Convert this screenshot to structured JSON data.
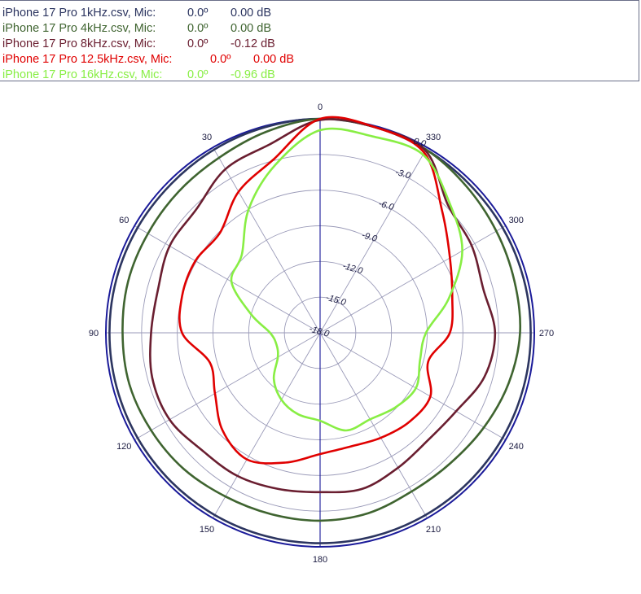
{
  "legend": [
    {
      "name": "iPhone 17 Pro 1kHz.csv, Mic:",
      "angle": "0.0º",
      "level": "0.00 dB",
      "color": "#2c3560"
    },
    {
      "name": "iPhone 17 Pro 4kHz.csv, Mic:",
      "angle": "0.0º",
      "level": "0.00 dB",
      "color": "#3f6430"
    },
    {
      "name": "iPhone 17 Pro 8kHz.csv, Mic:",
      "angle": "0.0º",
      "level": "-0.12 dB",
      "color": "#6a1e30"
    },
    {
      "name": "iPhone 17 Pro 12.5kHz.csv, Mic:",
      "angle": "0.0º",
      "level": "0.00 dB",
      "color": "#e00000"
    },
    {
      "name": "iPhone 17 Pro 16kHz.csv, Mic:",
      "angle": "0.0º",
      "level": "-0.96 dB",
      "color": "#88ee44"
    }
  ],
  "chart_data": {
    "type": "polar",
    "angle_labels": [
      "0",
      "30",
      "60",
      "90",
      "120",
      "150",
      "180",
      "210",
      "240",
      "270",
      "300",
      "330"
    ],
    "radial_labels": [
      "0.0",
      "-3.0",
      "-6.0",
      "-9.0",
      "-12.0",
      "-15.0",
      "-18.0"
    ],
    "rlim": [
      -18,
      0
    ],
    "outer_circle_color": "#1a1a99",
    "spoke_color": "#9a9ab8",
    "zero_spoke_color": "#1a1a99",
    "series": [
      {
        "name": "iPhone 17 Pro 1kHz.csv, Mic:",
        "color": "#2c3560",
        "angles": [
          0,
          15,
          30,
          45,
          60,
          75,
          90,
          105,
          120,
          135,
          150,
          165,
          180,
          195,
          210,
          225,
          240,
          255,
          270,
          285,
          300,
          315,
          330,
          345
        ],
        "values": [
          0,
          -0.1,
          -0.2,
          -0.3,
          -0.3,
          -0.3,
          -0.3,
          -0.3,
          -0.3,
          -0.3,
          -0.3,
          -0.3,
          -0.3,
          -0.3,
          -0.3,
          -0.3,
          -0.3,
          -0.3,
          -0.3,
          -0.3,
          -0.3,
          -0.3,
          -0.2,
          -0.1
        ]
      },
      {
        "name": "iPhone 17 Pro 4kHz.csv, Mic:",
        "color": "#3f6430",
        "angles": [
          0,
          15,
          30,
          45,
          60,
          75,
          90,
          105,
          120,
          135,
          150,
          165,
          180,
          195,
          210,
          225,
          240,
          255,
          270,
          285,
          300,
          315,
          330,
          345
        ],
        "values": [
          0,
          -0.5,
          -1.0,
          -1.2,
          -1.3,
          -1.3,
          -1.4,
          -1.4,
          -1.6,
          -1.8,
          -2.1,
          -2.2,
          -2.2,
          -2.3,
          -2.6,
          -2.5,
          -2.1,
          -1.6,
          -1.2,
          -1.1,
          -0.9,
          -0.6,
          -0.2,
          -0.1
        ]
      },
      {
        "name": "iPhone 17 Pro 8kHz.csv, Mic:",
        "color": "#6a1e30",
        "angles": [
          0,
          15,
          30,
          45,
          60,
          75,
          90,
          105,
          120,
          135,
          150,
          165,
          180,
          195,
          210,
          225,
          240,
          255,
          270,
          285,
          300,
          315,
          330,
          345
        ],
        "values": [
          -0.1,
          -1.6,
          -2.1,
          -3.3,
          -3.4,
          -3.9,
          -3.8,
          -3.4,
          -3.4,
          -4.0,
          -4.1,
          -4.4,
          -4.6,
          -4.4,
          -4.9,
          -5.2,
          -4.8,
          -3.7,
          -3.3,
          -3.8,
          -3.3,
          -2.8,
          -0.3,
          -0.1
        ]
      },
      {
        "name": "iPhone 17 Pro 12.5kHz.csv, Mic:",
        "color": "#e00000",
        "angles": [
          0,
          15,
          30,
          45,
          60,
          75,
          90,
          105,
          120,
          135,
          150,
          165,
          180,
          195,
          210,
          225,
          240,
          255,
          270,
          285,
          300,
          315,
          330,
          345
        ],
        "values": [
          0,
          -2.9,
          -4.3,
          -6.1,
          -5.9,
          -6.0,
          -6.4,
          -8.4,
          -7.8,
          -6.4,
          -5.7,
          -6.7,
          -7.8,
          -8.1,
          -7.8,
          -7.4,
          -7.3,
          -8.6,
          -7.1,
          -6.5,
          -5.4,
          -3.5,
          -0.5,
          -0.1
        ]
      },
      {
        "name": "iPhone 17 Pro 16kHz.csv, Mic:",
        "color": "#88ee44",
        "angles": [
          0,
          15,
          30,
          45,
          60,
          75,
          90,
          105,
          120,
          135,
          150,
          165,
          180,
          195,
          210,
          225,
          240,
          255,
          270,
          285,
          300,
          315,
          330,
          345
        ],
        "values": [
          -0.96,
          -3.4,
          -6.0,
          -8.7,
          -9.4,
          -12.0,
          -13.8,
          -14.2,
          -13.9,
          -12.5,
          -11.5,
          -10.9,
          -10.6,
          -9.5,
          -9.6,
          -9.1,
          -8.7,
          -9.3,
          -9.1,
          -6.8,
          -4.2,
          -2.6,
          -0.7,
          -0.9
        ]
      }
    ]
  }
}
